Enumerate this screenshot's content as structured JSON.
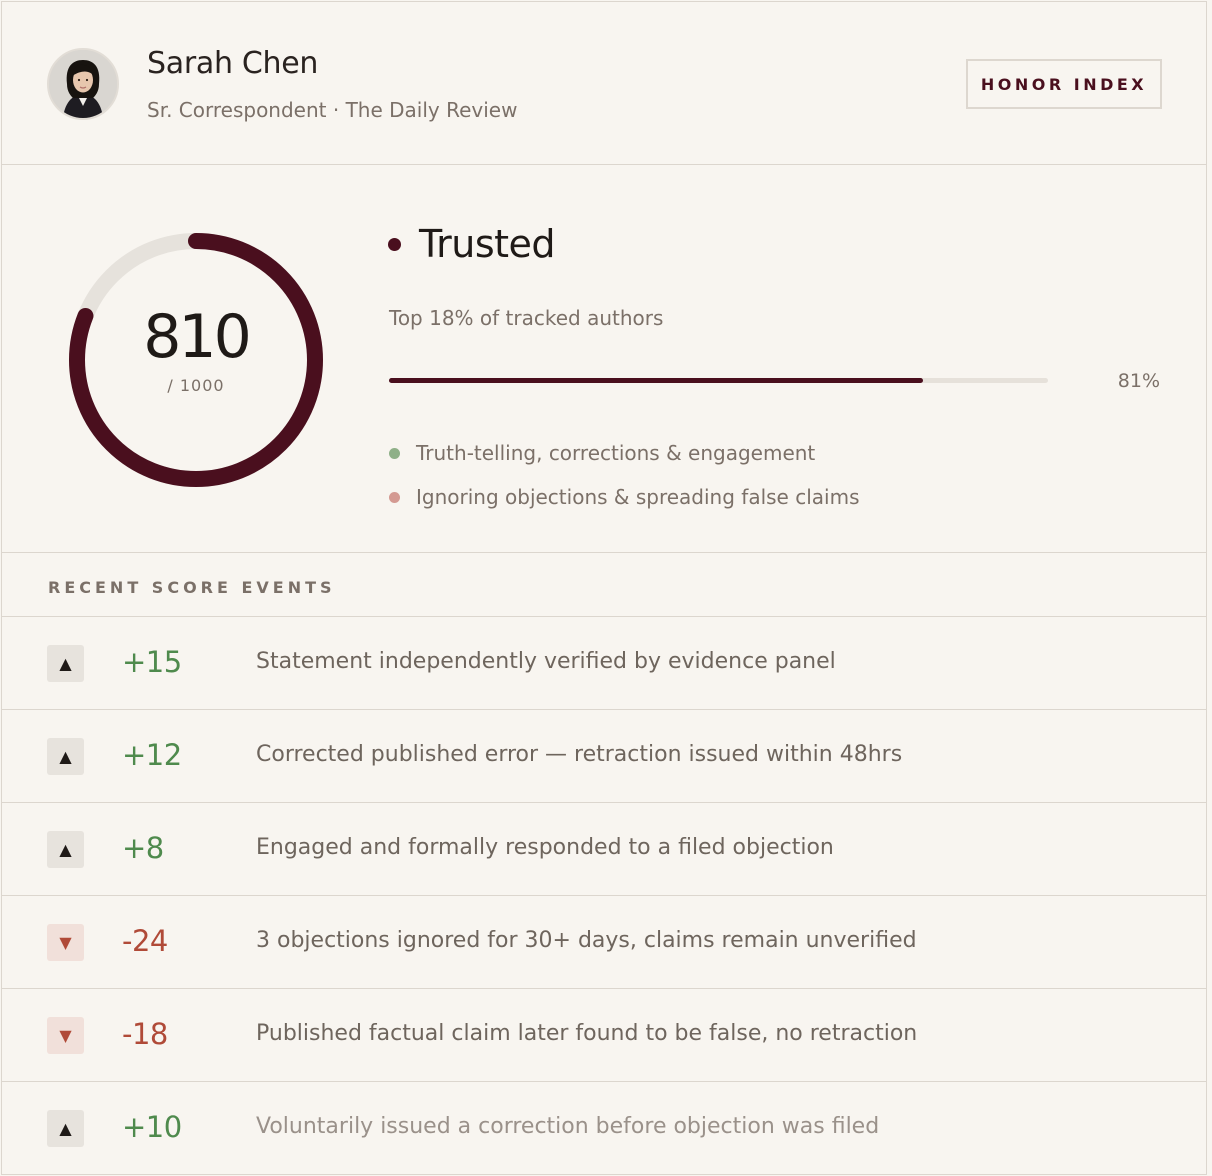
{
  "profile": {
    "name": "Sarah Chen",
    "subtitle": "Sr. Correspondent · The Daily Review",
    "badge": "HONOR INDEX"
  },
  "score": {
    "value": "810",
    "max_label": "/ 1000",
    "value_num": 810,
    "max_num": 1000,
    "tier": "Trusted",
    "percentile_text": "Top 18% of tracked authors",
    "progress_pct": 81,
    "progress_label": "81%",
    "legend": [
      {
        "label": "Truth-telling, corrections & engagement",
        "color": "#8fb088"
      },
      {
        "label": "Ignoring objections & spreading false claims",
        "color": "#d49a92"
      }
    ]
  },
  "events": {
    "title": "RECENT SCORE EVENTS",
    "items": [
      {
        "direction": "up",
        "icon": "triangle-up-icon",
        "delta": "+15",
        "description": "Statement independently verified by evidence panel"
      },
      {
        "direction": "up",
        "icon": "triangle-up-icon",
        "delta": "+12",
        "description": "Corrected published error — retraction issued within 48hrs"
      },
      {
        "direction": "up",
        "icon": "triangle-up-icon",
        "delta": "+8",
        "description": "Engaged and formally responded to a filed objection"
      },
      {
        "direction": "down",
        "icon": "triangle-down-icon",
        "delta": "-24",
        "description": "3 objections ignored for 30+ days, claims remain unverified"
      },
      {
        "direction": "down",
        "icon": "triangle-down-icon",
        "delta": "-18",
        "description": "Published factual claim later found to be false, no retraction"
      },
      {
        "direction": "up",
        "icon": "triangle-up-icon",
        "delta": "+10",
        "description": "Voluntarily issued a correction before objection was filed"
      }
    ]
  },
  "colors": {
    "accent": "#4a0f1e",
    "positive": "#4f8a4d",
    "negative": "#b04a38",
    "background": "#f8f5f0"
  }
}
